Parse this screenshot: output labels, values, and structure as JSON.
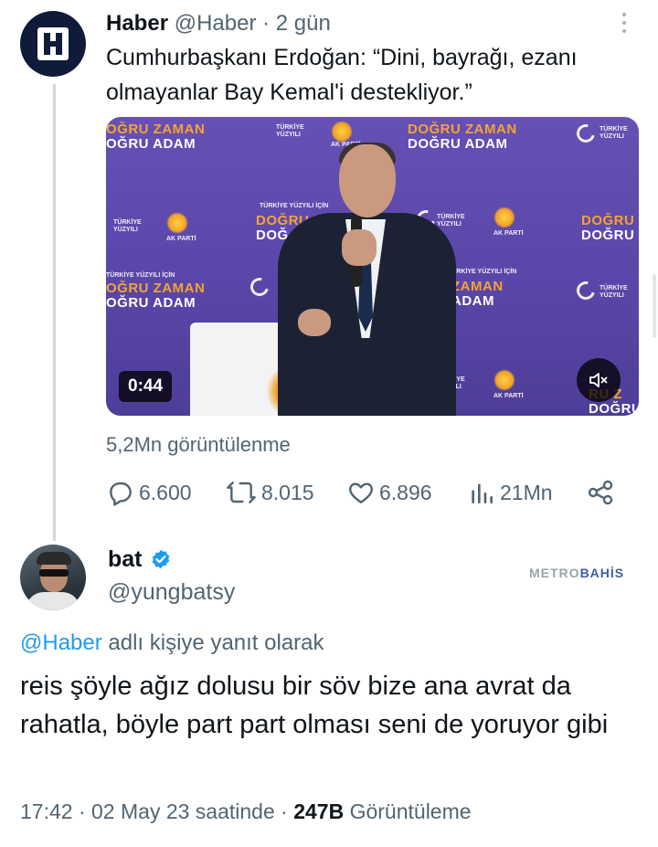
{
  "tweet": {
    "author_name": "Haber",
    "author_handle": "@Haber",
    "time_sep": " · ",
    "time": "2 gün",
    "avatar_letter": "H",
    "text": "Cumhurbaşkanı Erdoğan: “Dini, bayrağı, ezanı olmayanlar Bay Kemal'i destekliyor.”",
    "video": {
      "duration": "0:44",
      "backdrop": {
        "top_left": [
          "OĞRU ZAMAN",
          "OĞRU ADAM"
        ],
        "top_center": [
          "DOĞRU ZAMAN",
          "DOĞRU ADAM"
        ],
        "mid_center": [
          "DOĞRU ZAM",
          "DOĞ"
        ],
        "mid_right": [
          "DOĞRU Z",
          "DOĞRU"
        ],
        "lower_left": [
          "OĞRU ZAMAN",
          "OĞRU ADAM"
        ],
        "lower_center": [
          "ZAMAN",
          "ADAM"
        ],
        "bottom_right": [
          "RU Z",
          "DOĞRU"
        ],
        "small_logo": [
          "TÜRKİYE",
          "YÜZYILI"
        ],
        "small_banner": "TÜRKİYE YÜZYILI İÇİN",
        "ak_label": "AK PARTİ"
      }
    },
    "views": "5,2Mn görüntülenme",
    "actions": {
      "replies": "6.600",
      "retweets": "8.015",
      "likes": "6.896",
      "views": "21Mn"
    }
  },
  "reply": {
    "author_name": "bat",
    "author_handle": "@yungbatsy",
    "reply_to_mention": "@Haber",
    "reply_to_suffix": " adlı kişiye yanıt olarak",
    "text": "reis şöyle ağız dolusu bir söv bize ana avrat da rahatla, böyle part part olması seni de yoruyor gibi",
    "time": "17:42",
    "sep": " · ",
    "date": "02 May 23 saatinde",
    "view_count": "247B",
    "view_label": " Görüntüleme"
  },
  "watermark": {
    "part1": "METRO",
    "part2": "BAHİS"
  },
  "colors": {
    "accent": "#1d9bf0",
    "muted": "#536471",
    "text": "#0f1419",
    "video_bg": "#5a46a8",
    "verified": "#1d9bf0"
  },
  "icons": [
    "more-icon",
    "reply-icon",
    "retweet-icon",
    "like-icon",
    "views-icon",
    "share-icon",
    "mute-icon",
    "verified-badge-icon"
  ]
}
